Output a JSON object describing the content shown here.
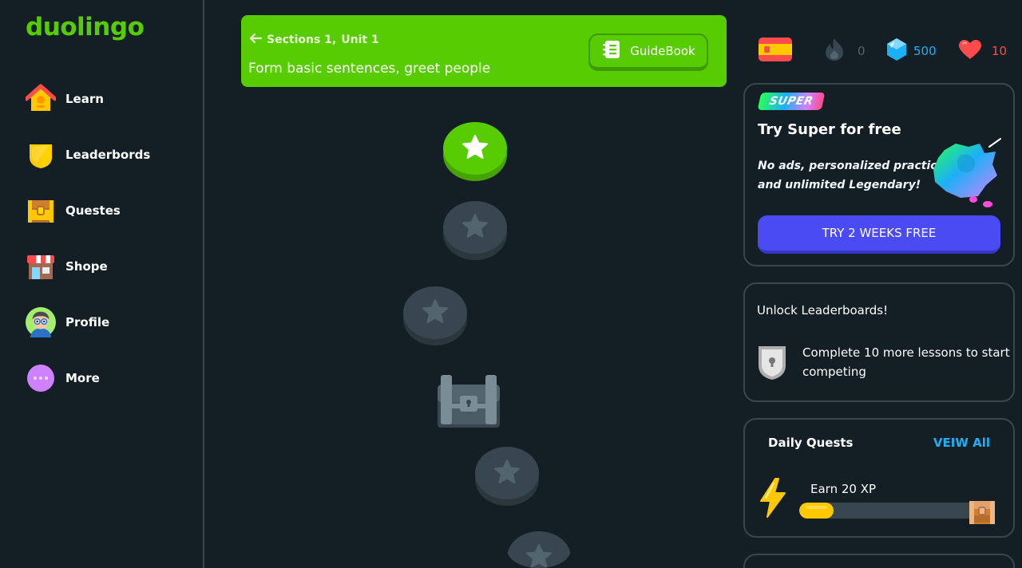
{
  "logo": {
    "text": "duolingo"
  },
  "sidebar": {
    "items": [
      {
        "label": "Learn",
        "icon": "house-icon"
      },
      {
        "label": "Leaderbords",
        "icon": "shield-icon"
      },
      {
        "label": "Questes",
        "icon": "treasure-chest-icon"
      },
      {
        "label": "Shope",
        "icon": "shop-icon"
      },
      {
        "label": "Profile",
        "icon": "avatar-icon"
      },
      {
        "label": "More",
        "icon": "more-dots-icon"
      }
    ]
  },
  "unit": {
    "section": "Sections 1,",
    "unit": "Unit 1",
    "title": "Form basic sentences, greet people",
    "guidebook_label": "GuideBook"
  },
  "stats": {
    "flag": "spain-flag-icon",
    "streak": "0",
    "gems": "500",
    "hearts": "10"
  },
  "super_card": {
    "badge": "SUPER",
    "title": "Try Super for free",
    "description": "No ads, personalized practice, and unlimited Legendary!",
    "button_label": "TRY 2 WEEKS FREE"
  },
  "leaderboard_card": {
    "title": "Unlock Leaderboards!",
    "text": "Complete 10 more lessons to start competing"
  },
  "quests_card": {
    "title": "Daily Quests",
    "view_all": "VEIW All",
    "quest_label": "Earn 20 XP",
    "progress_fraction": 0.19
  },
  "colors": {
    "accent_green": "#58cc02",
    "gem_blue": "#1cb0f6",
    "heart_red": "#ff4b4b",
    "super_purple": "#4b4bf4",
    "background": "#131f24"
  }
}
